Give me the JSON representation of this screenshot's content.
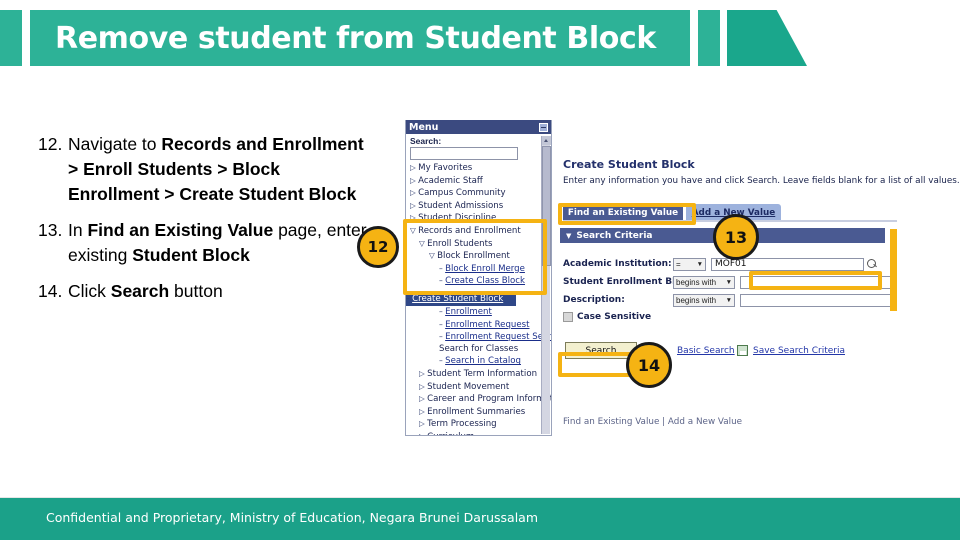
{
  "header": {
    "title": "Remove student from Student Block",
    "bar_color": "#2db297",
    "wedge_color": "#1aa78c"
  },
  "steps": [
    {
      "number": "12.",
      "segments": [
        {
          "text": "Navigate to ",
          "bold": false
        },
        {
          "text": "Records and Enrollment > Enroll Students > Block Enrollment > Create Student Block",
          "bold": true
        }
      ]
    },
    {
      "number": "13.",
      "segments": [
        {
          "text": "In ",
          "bold": false
        },
        {
          "text": "Find an Existing Value",
          "bold": true
        },
        {
          "text": " page, enter existing ",
          "bold": false
        },
        {
          "text": "Student Block",
          "bold": true
        }
      ]
    },
    {
      "number": "14.",
      "segments": [
        {
          "text": "Click ",
          "bold": false
        },
        {
          "text": "Search",
          "bold": true
        },
        {
          "text": " button",
          "bold": false
        }
      ]
    }
  ],
  "callouts": [
    {
      "id": "12",
      "label": "12"
    },
    {
      "id": "13",
      "label": "13"
    },
    {
      "id": "14",
      "label": "14"
    }
  ],
  "screenshot": {
    "menu": {
      "title": "Menu",
      "collapse_icon": "minimize-icon",
      "search_label": "Search:",
      "search_value": "",
      "items": [
        {
          "label": "My Favorites",
          "level": 1,
          "marker": "collapsed",
          "style": "plain"
        },
        {
          "label": "Academic Staff",
          "level": 1,
          "marker": "collapsed",
          "style": "plain"
        },
        {
          "label": "Campus Community",
          "level": 1,
          "marker": "collapsed",
          "style": "plain"
        },
        {
          "label": "Student Admissions",
          "level": 1,
          "marker": "collapsed",
          "style": "plain"
        },
        {
          "label": "Student Discipline",
          "level": 1,
          "marker": "collapsed",
          "style": "plain"
        },
        {
          "label": "Records and Enrollment",
          "level": 1,
          "marker": "expanded",
          "style": "plain"
        },
        {
          "label": "Enroll Students",
          "level": 2,
          "marker": "expanded",
          "style": "plain"
        },
        {
          "label": "Block Enrollment",
          "level": 3,
          "marker": "expanded",
          "style": "plain"
        },
        {
          "label": "Block Enroll Merge",
          "level": 4,
          "marker": "dash",
          "style": "link"
        },
        {
          "label": "Create Class Block",
          "level": 4,
          "marker": "dash",
          "style": "link"
        },
        {
          "label": "Create Student Block",
          "level": 4,
          "marker": "dash",
          "style": "selected"
        },
        {
          "label": "Enrollment",
          "level": 4,
          "marker": "dash",
          "style": "link"
        },
        {
          "label": "Enrollment Request",
          "level": 4,
          "marker": "dash",
          "style": "link"
        },
        {
          "label": "Enrollment Request Search",
          "level": 4,
          "marker": "dash",
          "style": "link"
        },
        {
          "label": "Search for Classes",
          "level": 4,
          "marker": "none",
          "style": "plain"
        },
        {
          "label": "Search in Catalog",
          "level": 4,
          "marker": "dash",
          "style": "link"
        },
        {
          "label": "Student Term Information",
          "level": 2,
          "marker": "collapsed",
          "style": "plain"
        },
        {
          "label": "Student Movement",
          "level": 2,
          "marker": "collapsed",
          "style": "plain"
        },
        {
          "label": "Career and Program Information",
          "level": 2,
          "marker": "collapsed",
          "style": "plain"
        },
        {
          "label": "Enrollment Summaries",
          "level": 2,
          "marker": "collapsed",
          "style": "plain"
        },
        {
          "label": "Term Processing",
          "level": 2,
          "marker": "collapsed",
          "style": "plain"
        },
        {
          "label": "Curriculum",
          "level": 2,
          "marker": "collapsed",
          "style": "plain"
        }
      ]
    },
    "page": {
      "title": "Create Student Block",
      "instructions": "Enter any information you have and click Search. Leave fields blank for a list of all values.",
      "tabs": [
        {
          "label": "Find an Existing Value",
          "active": true
        },
        {
          "label": "Add a New Value",
          "active": false
        }
      ],
      "section_header": "Search Criteria",
      "fields": [
        {
          "label": "Academic Institution:",
          "operator": "=",
          "value": "MOF01",
          "has_lookup": true
        },
        {
          "label": "Student Enrollment Block:",
          "operator": "begins with",
          "value": "",
          "has_lookup": false
        },
        {
          "label": "Description:",
          "operator": "begins with",
          "value": "",
          "has_lookup": false
        }
      ],
      "case_sensitive_label": "Case Sensitive",
      "case_sensitive_checked": false,
      "search_button": "Search",
      "basic_search_link": "Basic Search",
      "save_search_link": "Save Search Criteria",
      "save_icon": "floppy-disk-icon",
      "bottom_links": "Find an Existing Value  |  Add a New Value"
    }
  },
  "highlight_color": "#f5b313",
  "footer": {
    "text": "Confidential and Proprietary, Ministry of Education, Negara Brunei Darussalam",
    "color": "#1ba189"
  }
}
